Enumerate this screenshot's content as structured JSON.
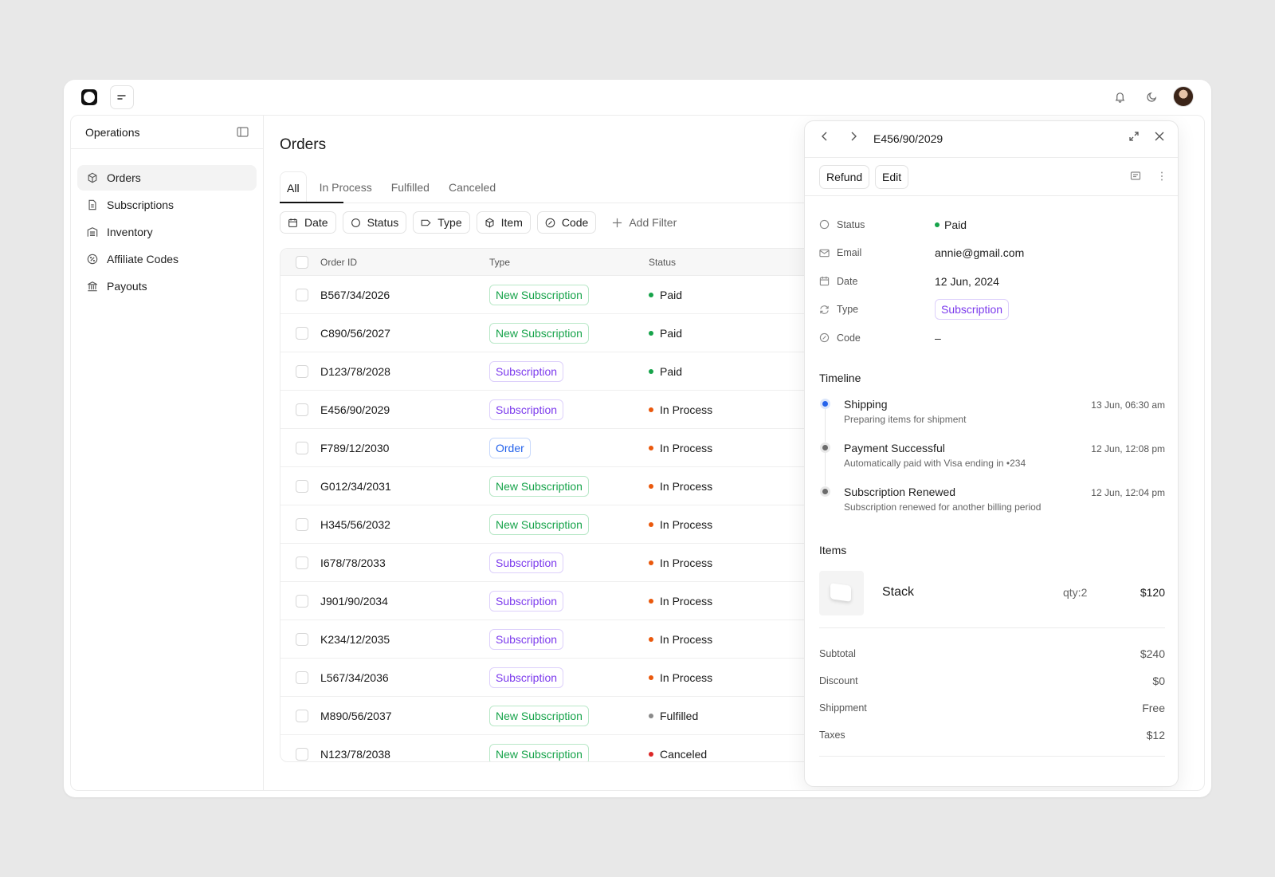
{
  "sidebar": {
    "title": "Operations",
    "items": [
      {
        "label": "Orders",
        "icon": "box-icon"
      },
      {
        "label": "Subscriptions",
        "icon": "document-icon"
      },
      {
        "label": "Inventory",
        "icon": "warehouse-icon"
      },
      {
        "label": "Affiliate Codes",
        "icon": "discount-icon"
      },
      {
        "label": "Payouts",
        "icon": "bank-icon"
      }
    ]
  },
  "main": {
    "title": "Orders",
    "tabs": [
      "All",
      "In Process",
      "Fulfilled",
      "Canceled"
    ],
    "filters": [
      "Date",
      "Status",
      "Type",
      "Item",
      "Code"
    ],
    "add_filter": "Add Filter",
    "columns": {
      "id": "Order ID",
      "type": "Type",
      "status": "Status"
    },
    "rows": [
      {
        "id": "B567/34/2026",
        "type": "New Subscription",
        "status": "Paid"
      },
      {
        "id": "C890/56/2027",
        "type": "New Subscription",
        "status": "Paid"
      },
      {
        "id": "D123/78/2028",
        "type": "Subscription",
        "status": "Paid"
      },
      {
        "id": "E456/90/2029",
        "type": "Subscription",
        "status": "In Process"
      },
      {
        "id": "F789/12/2030",
        "type": "Order",
        "status": "In Process"
      },
      {
        "id": "G012/34/2031",
        "type": "New Subscription",
        "status": "In Process"
      },
      {
        "id": "H345/56/2032",
        "type": "New Subscription",
        "status": "In Process"
      },
      {
        "id": "I678/78/2033",
        "type": "Subscription",
        "status": "In Process"
      },
      {
        "id": "J901/90/2034",
        "type": "Subscription",
        "status": "In Process"
      },
      {
        "id": "K234/12/2035",
        "type": "Subscription",
        "status": "In Process"
      },
      {
        "id": "L567/34/2036",
        "type": "Subscription",
        "status": "In Process"
      },
      {
        "id": "M890/56/2037",
        "type": "New Subscription",
        "status": "Fulfilled"
      },
      {
        "id": "N123/78/2038",
        "type": "New Subscription",
        "status": "Canceled"
      }
    ]
  },
  "colors": {
    "paid": "#16a34a",
    "in_process": "#ea580c",
    "fulfilled": "#8a8a8a",
    "canceled": "#dc2626",
    "new_subscription": "#16a34a",
    "subscription": "#7c3aed",
    "order": "#2563eb",
    "timeline_active": "#2563eb",
    "timeline_done": "#6b6b6b"
  },
  "panel": {
    "order_id": "E456/90/2029",
    "actions": {
      "refund": "Refund",
      "edit": "Edit"
    },
    "props": {
      "status_label": "Status",
      "status_value": "Paid",
      "email_label": "Email",
      "email_value": "annie@gmail.com",
      "date_label": "Date",
      "date_value": "12 Jun, 2024",
      "type_label": "Type",
      "type_value": "Subscription",
      "code_label": "Code",
      "code_value": "–"
    },
    "timeline_title": "Timeline",
    "timeline": [
      {
        "title": "Shipping",
        "desc": "Preparing items for shipment",
        "time": "13 Jun, 06:30 am"
      },
      {
        "title": "Payment Successful",
        "desc": "Automatically paid with Visa ending in •234",
        "time": "12 Jun, 12:08 pm"
      },
      {
        "title": "Subscription Renewed",
        "desc": "Subscription renewed for another billing period",
        "time": "12 Jun, 12:04 pm"
      }
    ],
    "items_title": "Items",
    "item": {
      "name": "Stack",
      "qty": "qty:2",
      "price": "$120"
    },
    "totals": [
      {
        "label": "Subtotal",
        "value": "$240"
      },
      {
        "label": "Discount",
        "value": "$0"
      },
      {
        "label": "Shippment",
        "value": "Free"
      },
      {
        "label": "Taxes",
        "value": "$12"
      }
    ]
  }
}
